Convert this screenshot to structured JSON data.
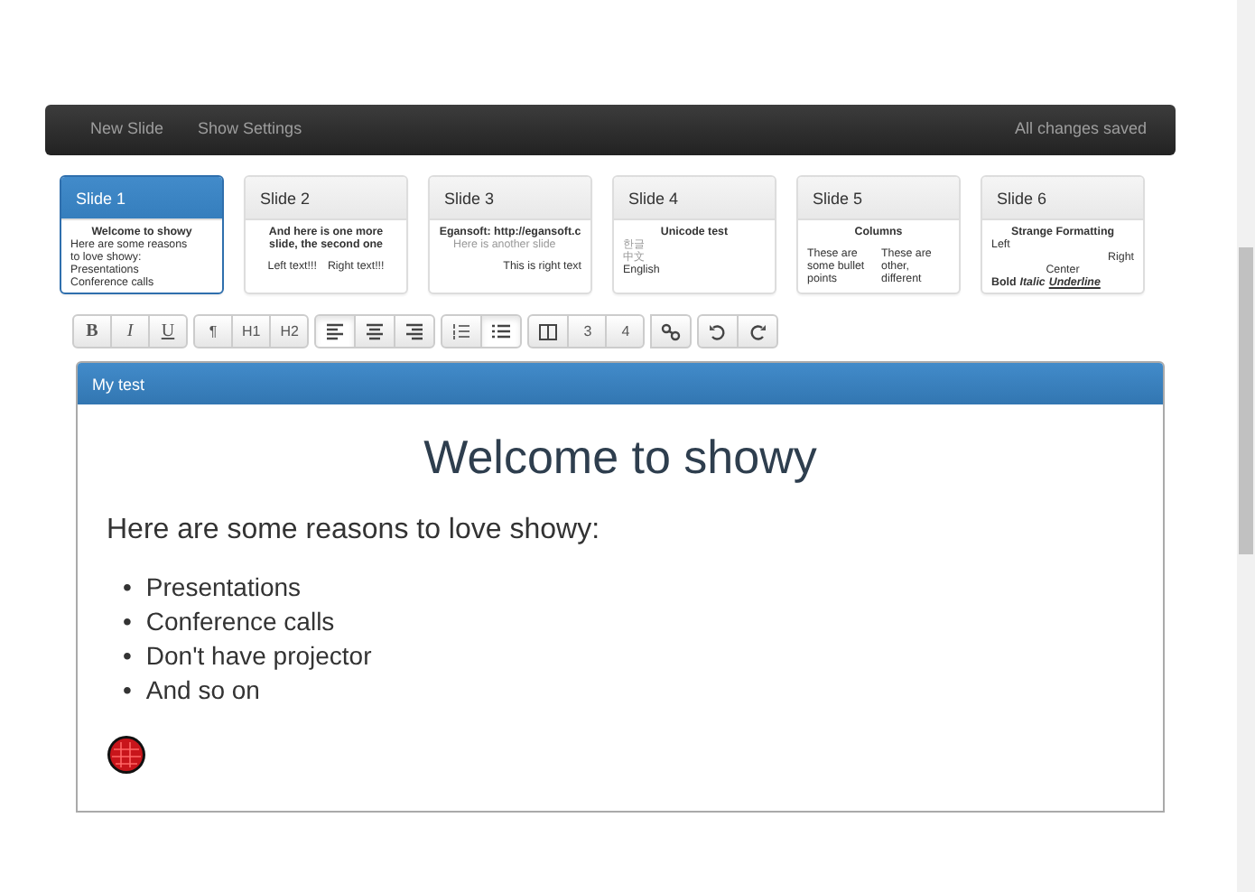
{
  "navbar": {
    "links": [
      "New Slide",
      "Show Settings"
    ],
    "status": "All changes saved"
  },
  "slides": [
    {
      "title": "Slide 1",
      "selected": true,
      "preview": [
        {
          "kind": "heading",
          "text": "Welcome to showy"
        },
        {
          "kind": "text",
          "text": "Here are some reasons"
        },
        {
          "kind": "text",
          "text": "to love showy:"
        },
        {
          "kind": "text",
          "text": "Presentations"
        },
        {
          "kind": "text",
          "text": "Conference calls"
        }
      ]
    },
    {
      "title": "Slide 2",
      "selected": false,
      "preview": [
        {
          "kind": "heading",
          "text": "And here is one more slide, the second one"
        },
        {
          "kind": "pair",
          "texts": [
            "Left text!!!",
            "Right text!!!"
          ]
        }
      ]
    },
    {
      "title": "Slide 3",
      "selected": false,
      "preview": [
        {
          "kind": "heading",
          "text": "Egansoft: http://egansoft.c"
        },
        {
          "kind": "muted",
          "text": "Here is another slide"
        },
        {
          "kind": "right",
          "text": "This is right text"
        }
      ]
    },
    {
      "title": "Slide 4",
      "selected": false,
      "preview": [
        {
          "kind": "heading",
          "text": "Unicode test"
        },
        {
          "kind": "muted",
          "text": "한글"
        },
        {
          "kind": "muted",
          "text": "中文"
        },
        {
          "kind": "text",
          "text": "English"
        }
      ]
    },
    {
      "title": "Slide 5",
      "selected": false,
      "preview": [
        {
          "kind": "heading",
          "text": "Columns"
        },
        {
          "kind": "columns",
          "texts": [
            "These are some bullet points",
            "These are other, different"
          ]
        }
      ]
    },
    {
      "title": "Slide 6",
      "selected": false,
      "preview": [
        {
          "kind": "heading",
          "text": "Strange Formatting"
        },
        {
          "kind": "text",
          "text": "Left"
        },
        {
          "kind": "right",
          "text": "Right"
        },
        {
          "kind": "center",
          "text": "Center"
        },
        {
          "kind": "styled",
          "parts": [
            {
              "kind": "bold",
              "text": "Bold"
            },
            {
              "kind": "italic",
              "text": "Italic"
            },
            {
              "kind": "underline",
              "text": "Underline"
            }
          ]
        }
      ]
    }
  ],
  "toolbar": [
    [
      {
        "kind": "bold",
        "label": "B",
        "active": false
      },
      {
        "kind": "italic",
        "label": "I",
        "active": false
      },
      {
        "kind": "underline",
        "label": "U",
        "active": false
      }
    ],
    [
      {
        "kind": "text",
        "label": "¶",
        "active": false
      },
      {
        "kind": "text",
        "label": "H1",
        "active": false
      },
      {
        "kind": "text",
        "label": "H2",
        "active": false
      }
    ],
    [
      {
        "kind": "align-left",
        "active": true
      },
      {
        "kind": "align-center",
        "active": false
      },
      {
        "kind": "align-right",
        "active": false
      }
    ],
    [
      {
        "kind": "numbered-list",
        "active": false
      },
      {
        "kind": "bullet-list",
        "active": true
      }
    ],
    [
      {
        "kind": "columns",
        "active": false
      },
      {
        "kind": "text",
        "label": "3",
        "active": false
      },
      {
        "kind": "text",
        "label": "4",
        "active": false
      }
    ],
    [
      {
        "kind": "link",
        "active": false
      }
    ],
    [
      {
        "kind": "undo",
        "active": false
      },
      {
        "kind": "redo",
        "active": false
      }
    ]
  ],
  "editor": {
    "title": "My test",
    "heading": "Welcome to showy",
    "paragraph": "Here are some reasons to love showy:",
    "items": [
      {
        "marker": "•",
        "text": "Presentations"
      },
      {
        "marker": "•",
        "text": "Conference calls"
      },
      {
        "marker": "•",
        "text": "Don't have projector"
      },
      {
        "marker": "•",
        "text": "And so on"
      }
    ]
  }
}
